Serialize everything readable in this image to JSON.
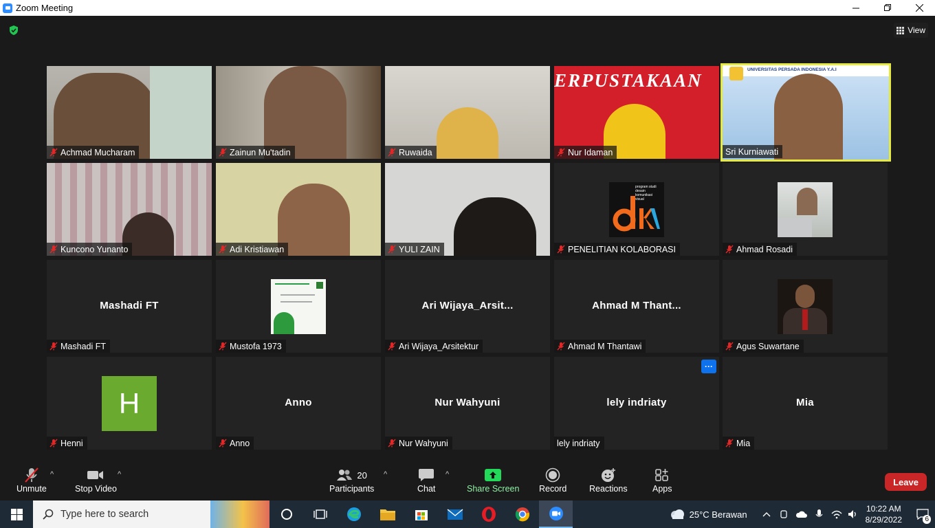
{
  "window": {
    "title": "Zoom Meeting"
  },
  "view_button": {
    "label": "View"
  },
  "tiles": [
    {
      "name": "Achmad Mucharam",
      "type": "video"
    },
    {
      "name": "Zainun Mu'tadin",
      "type": "video"
    },
    {
      "name": "Ruwaida",
      "type": "video"
    },
    {
      "name": "Nur Idaman",
      "type": "video",
      "banner": "ERPUSTAKAAN"
    },
    {
      "name": "Sri Kurniawati",
      "type": "video",
      "active": true,
      "banner": "UNIVERSITAS PERSADA INDONESIA Y.A.I"
    },
    {
      "name": "Kuncono Yunanto",
      "type": "video"
    },
    {
      "name": "Adi Kristiawan",
      "type": "video"
    },
    {
      "name": "YULI ZAIN",
      "type": "video"
    },
    {
      "name": "PENELITIAN KOLABORASI",
      "type": "picture",
      "logo_lines": [
        "program studi",
        "desain",
        "komunikasi",
        "visual"
      ]
    },
    {
      "name": "Ahmad Rosadi",
      "type": "picture"
    },
    {
      "name": "Mashadi FT",
      "type": "name",
      "display": "Mashadi FT"
    },
    {
      "name": "Mustofa 1973",
      "type": "picture"
    },
    {
      "name": "Ari Wijaya_Arsitektur",
      "type": "name",
      "display": "Ari  Wijaya_Arsit..."
    },
    {
      "name": "Ahmad M Thantawi",
      "type": "name",
      "display": "Ahmad  M  Thant..."
    },
    {
      "name": "Agus Suwartane",
      "type": "picture"
    },
    {
      "name": "Henni",
      "type": "avatar",
      "initial": "H"
    },
    {
      "name": "Anno",
      "type": "name",
      "display": "Anno"
    },
    {
      "name": "Nur Wahyuni",
      "type": "name",
      "display": "Nur Wahyuni"
    },
    {
      "name": "lely indriaty",
      "type": "name",
      "display": "lely indriaty",
      "no_mute": true,
      "menu": "···"
    },
    {
      "name": "Mia",
      "type": "name",
      "display": "Mia"
    }
  ],
  "toolbar": {
    "unmute": "Unmute",
    "stop_video": "Stop Video",
    "participants": "Participants",
    "participants_count": "20",
    "chat": "Chat",
    "share_screen": "Share Screen",
    "record": "Record",
    "reactions": "Reactions",
    "apps": "Apps",
    "leave": "Leave"
  },
  "taskbar": {
    "search_placeholder": "Type here to search",
    "weather": "25°C  Berawan",
    "time": "10:22 AM",
    "date": "8/29/2022",
    "notifications": "6"
  },
  "colors": {
    "accent": "#2d8cff",
    "leave": "#c92727",
    "share": "#23d959",
    "active_speaker": "#e6e940"
  }
}
